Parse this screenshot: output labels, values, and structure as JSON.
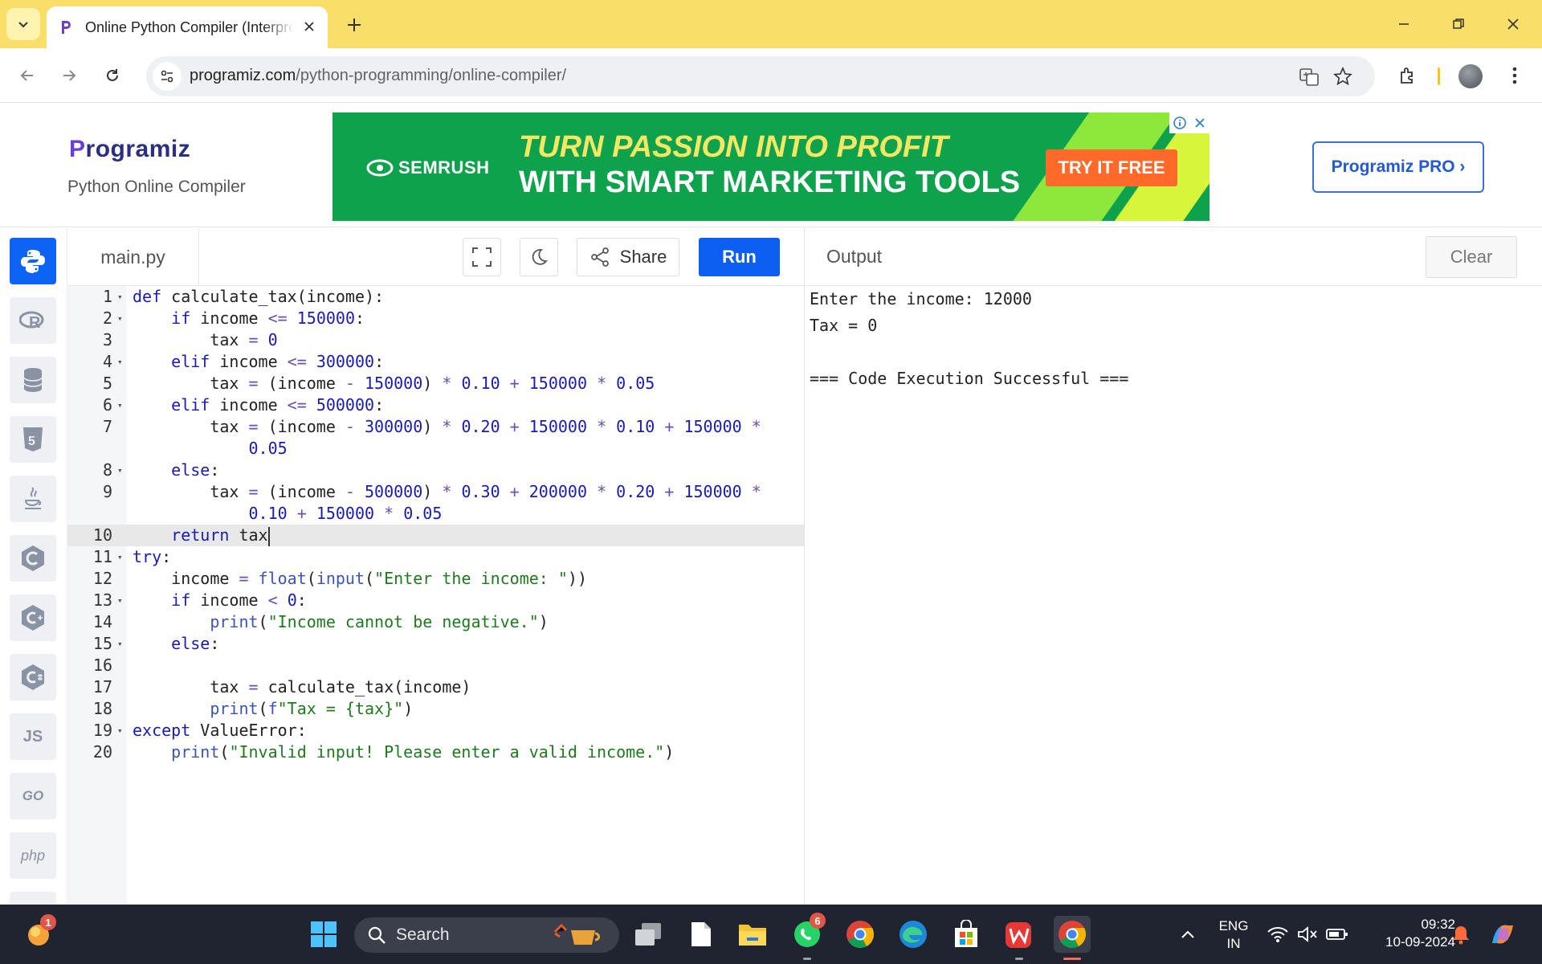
{
  "browser": {
    "tab_title": "Online Python Compiler (Interpreter)",
    "url_domain": "programiz.com",
    "url_path": "/python-programming/online-compiler/"
  },
  "header": {
    "logo": "rogramiz",
    "logo_letter": "P",
    "subtitle": "Python Online Compiler",
    "pro_button": "Programiz PRO ›"
  },
  "ad": {
    "brand": "SEMRUSH",
    "line1": "TURN PASSION INTO PROFIT",
    "line2": "WITH SMART MARKETING TOOLS",
    "cta": "TRY IT FREE"
  },
  "languages": [
    "python",
    "r",
    "sql",
    "html5",
    "java",
    "c",
    "cpp",
    "csharp",
    "JS",
    "GO",
    "php"
  ],
  "editor": {
    "filename": "main.py",
    "share_label": "Share",
    "run_label": "Run",
    "active_line": 10,
    "lines": [
      {
        "n": "1",
        "text": "def calculate_tax(income):"
      },
      {
        "n": "2",
        "text": "    if income <= 150000:"
      },
      {
        "n": "3",
        "text": "        tax = 0"
      },
      {
        "n": "4",
        "text": "    elif income <= 300000:"
      },
      {
        "n": "5",
        "text": "        tax = (income - 150000) * 0.10 + 150000 * 0.05"
      },
      {
        "n": "6",
        "text": "    elif income <= 500000:"
      },
      {
        "n": "7",
        "text": "        tax = (income - 300000) * 0.20 + 150000 * 0.10 + 150000 *"
      },
      {
        "n": "",
        "text": "            0.05"
      },
      {
        "n": "8",
        "text": "    else:"
      },
      {
        "n": "9",
        "text": "        tax = (income - 500000) * 0.30 + 200000 * 0.20 + 150000 *"
      },
      {
        "n": "",
        "text": "            0.10 + 150000 * 0.05"
      },
      {
        "n": "10",
        "text": "    return tax"
      },
      {
        "n": "11",
        "text": "try:"
      },
      {
        "n": "12",
        "text": "    income = float(input(\"Enter the income: \"))"
      },
      {
        "n": "13",
        "text": "    if income < 0:"
      },
      {
        "n": "14",
        "text": "        print(\"Income cannot be negative.\")"
      },
      {
        "n": "15",
        "text": "    else:"
      },
      {
        "n": "16",
        "text": ""
      },
      {
        "n": "17",
        "text": "        tax = calculate_tax(income)"
      },
      {
        "n": "18",
        "text": "        print(f\"Tax = {tax}\")"
      },
      {
        "n": "19",
        "text": "except ValueError:"
      },
      {
        "n": "20",
        "text": "    print(\"Invalid input! Please enter a valid income.\")"
      }
    ]
  },
  "output": {
    "title": "Output",
    "clear_label": "Clear",
    "lines": [
      "Enter the income: 12000",
      "Tax = 0",
      "",
      "=== Code Execution Successful ==="
    ]
  },
  "taskbar": {
    "search_label": "Search",
    "notification_count": "1",
    "whatsapp_badge": "6",
    "lang_top": "ENG",
    "lang_bottom": "IN",
    "time": "09:32",
    "date": "10-09-2024"
  }
}
